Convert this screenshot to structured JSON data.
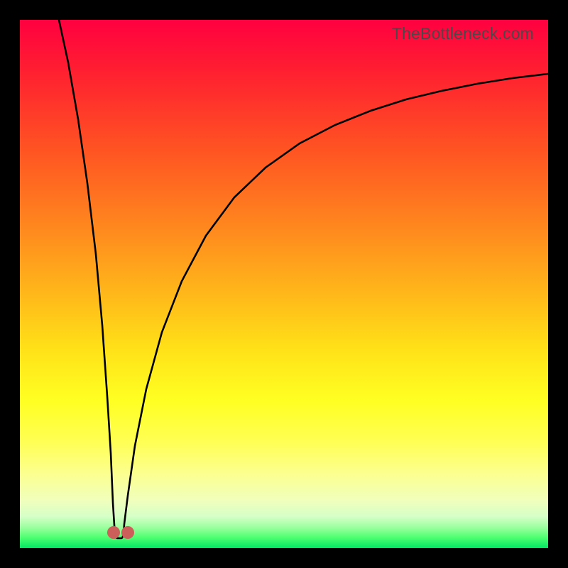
{
  "watermark": "TheBottleneck.com",
  "chart_data": {
    "type": "line",
    "title": "",
    "xlabel": "",
    "ylabel": "",
    "xlim": [
      0,
      1
    ],
    "ylim": [
      0,
      1
    ],
    "series": [
      {
        "name": "bottleneck-curve",
        "x": [
          0.0,
          0.02,
          0.04,
          0.06,
          0.08,
          0.1,
          0.12,
          0.14,
          0.16,
          0.17,
          0.175,
          0.18,
          0.185,
          0.19,
          0.21,
          0.22,
          0.24,
          0.26,
          0.28,
          0.3,
          0.33,
          0.36,
          0.4,
          0.44,
          0.48,
          0.52,
          0.56,
          0.6,
          0.65,
          0.7,
          0.75,
          0.8,
          0.85,
          0.9,
          0.95,
          1.0
        ],
        "y": [
          1.0,
          0.89,
          0.78,
          0.67,
          0.56,
          0.44,
          0.33,
          0.22,
          0.08,
          0.02,
          0.0,
          0.0,
          0.0,
          0.02,
          0.1,
          0.16,
          0.25,
          0.33,
          0.4,
          0.46,
          0.53,
          0.59,
          0.65,
          0.7,
          0.74,
          0.77,
          0.79,
          0.82,
          0.84,
          0.86,
          0.87,
          0.88,
          0.89,
          0.9,
          0.905,
          0.91
        ]
      }
    ],
    "markers": [
      {
        "name": "left-minimum-marker",
        "x": 0.168,
        "y": 0.018
      },
      {
        "name": "right-minimum-marker",
        "x": 0.195,
        "y": 0.018
      }
    ],
    "gradient_stops": [
      {
        "offset": 0.0,
        "color": "#ff0040"
      },
      {
        "offset": 0.25,
        "color": "#ff5522"
      },
      {
        "offset": 0.52,
        "color": "#ffb81a"
      },
      {
        "offset": 0.72,
        "color": "#ffff22"
      },
      {
        "offset": 0.94,
        "color": "#d6ffc8"
      },
      {
        "offset": 1.0,
        "color": "#00e862"
      }
    ]
  }
}
